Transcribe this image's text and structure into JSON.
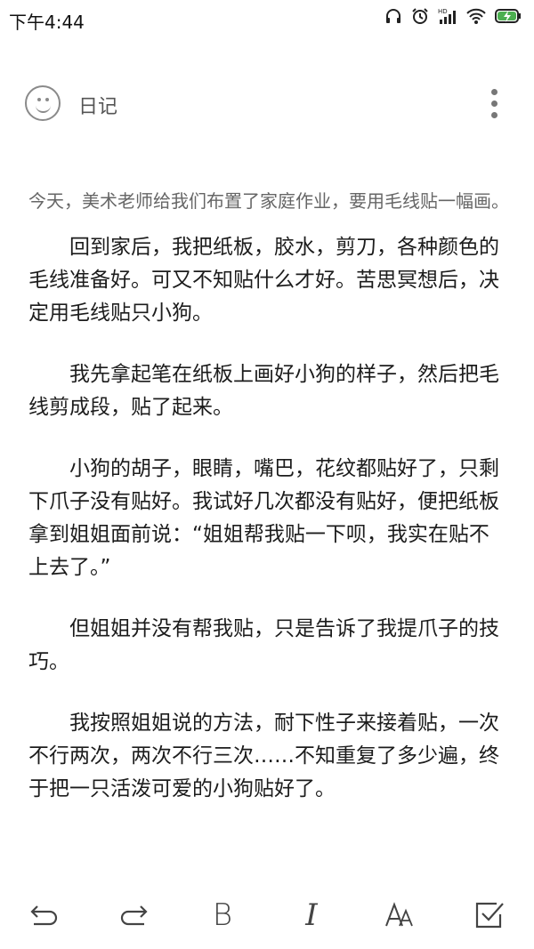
{
  "status_bar": {
    "time": "下午4:44",
    "icons": [
      "headphones-icon",
      "alarm-icon",
      "hd-signal-icon",
      "wifi-icon",
      "battery-charging-icon"
    ],
    "network_label": "HD",
    "battery_color": "#4caf50"
  },
  "header": {
    "mood_icon": "smiley-icon",
    "folder_label": "日记",
    "more_icon": "more-vertical-icon"
  },
  "note": {
    "intro": "今天，美术老师给我们布置了家庭作业，要用毛线贴一幅画。",
    "paragraphs": [
      "回到家后，我把纸板，胶水，剪刀，各种颜色的毛线准备好。可又不知贴什么才好。苦思冥想后，决定用毛线贴只小狗。",
      "我先拿起笔在纸板上画好小狗的样子，然后把毛线剪成段，贴了起来。",
      "小狗的胡子，眼睛，嘴巴，花纹都贴好了，只剩下爪子没有贴好。我试好几次都没有贴好，便把纸板拿到姐姐面前说：“姐姐帮我贴一下呗，我实在贴不上去了。”",
      "但姐姐并没有帮我贴，只是告诉了我提爪子的技巧。",
      "我按照姐姐说的方法，耐下性子来接着贴，一次不行两次，两次不行三次……不知重复了多少遍，终于把一只活泼可爱的小狗贴好了。"
    ]
  },
  "format_bar": {
    "undo_icon": "undo-icon",
    "redo_icon": "redo-icon",
    "bold_label": "B",
    "italic_label": "I",
    "font_size_icon": "font-size-icon",
    "checklist_icon": "checkbox-icon"
  }
}
